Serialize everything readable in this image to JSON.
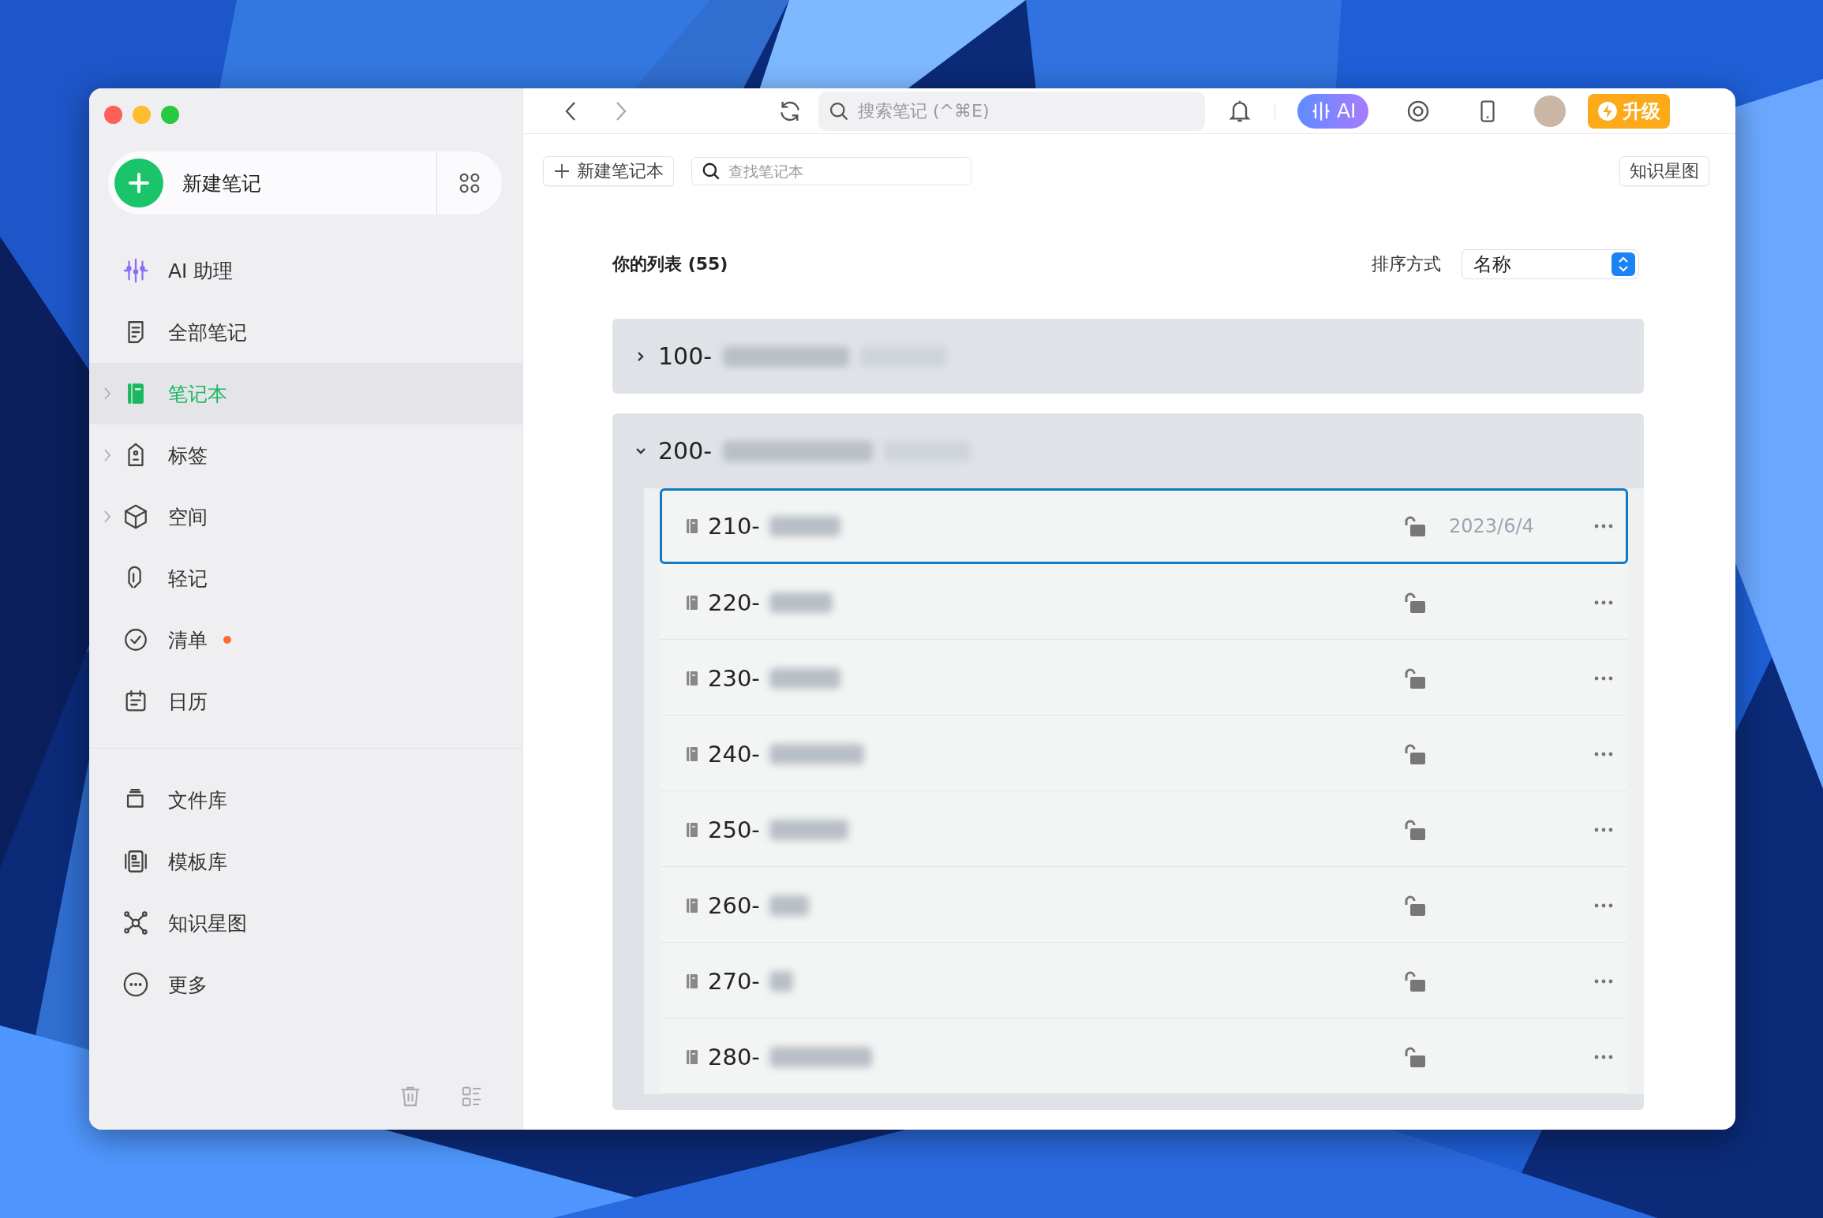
{
  "sidebar": {
    "new_note": {
      "label": "新建笔记"
    },
    "items": [
      {
        "label": "AI 助理",
        "selected": false,
        "expandable": false,
        "notification": false
      },
      {
        "label": "全部笔记",
        "selected": false,
        "expandable": false,
        "notification": false
      },
      {
        "label": "笔记本",
        "selected": true,
        "expandable": true,
        "notification": false
      },
      {
        "label": "标签",
        "selected": false,
        "expandable": true,
        "notification": false
      },
      {
        "label": "空间",
        "selected": false,
        "expandable": true,
        "notification": false
      },
      {
        "label": "轻记",
        "selected": false,
        "expandable": false,
        "notification": false
      },
      {
        "label": "清单",
        "selected": false,
        "expandable": false,
        "notification": true
      },
      {
        "label": "日历",
        "selected": false,
        "expandable": false,
        "notification": false
      }
    ],
    "library_items": [
      {
        "label": "文件库"
      },
      {
        "label": "模板库"
      },
      {
        "label": "知识星图"
      },
      {
        "label": "更多"
      }
    ]
  },
  "toolbar": {
    "search": {
      "placeholder": "搜索笔记 (^⌘E)"
    },
    "ai_button": "AI",
    "upgrade_button": "升级"
  },
  "content": {
    "new_notebook_button": "新建笔记本",
    "find": {
      "placeholder": "查找笔记本"
    },
    "graph_button": "知识星图",
    "list_title": "你的列表 (55)",
    "sort_label": "排序方式",
    "sort_value": "名称",
    "groups": [
      {
        "label": "100-",
        "expanded": false
      },
      {
        "label": "200-",
        "expanded": true,
        "children": [
          {
            "label": "210-",
            "date": "2023/6/4",
            "selected": true
          },
          {
            "label": "220-",
            "selected": false
          },
          {
            "label": "230-",
            "selected": false
          },
          {
            "label": "240-",
            "selected": false
          },
          {
            "label": "250-",
            "selected": false
          },
          {
            "label": "260-",
            "selected": false
          },
          {
            "label": "270-",
            "selected": false
          },
          {
            "label": "280-",
            "selected": false
          }
        ]
      }
    ]
  }
}
